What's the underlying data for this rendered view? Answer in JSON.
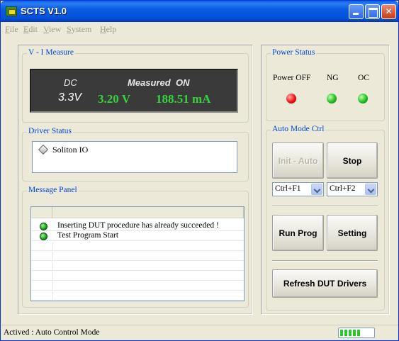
{
  "window": {
    "title": "SCTS V1.0"
  },
  "menu": {
    "items": [
      {
        "label": "File"
      },
      {
        "label": "Edit"
      },
      {
        "label": "View"
      },
      {
        "label": "System"
      },
      {
        "label": "Help"
      }
    ]
  },
  "vi_measure": {
    "group_label": "V - I Measure",
    "mode": "DC",
    "measured_label": "Measured",
    "measured_state": "ON",
    "set_voltage": "3.3V",
    "measured_voltage": "3.20 V",
    "measured_current": "188.51 mA"
  },
  "driver_status": {
    "group_label": "Driver Status",
    "items": [
      "Soliton IO"
    ]
  },
  "message_panel": {
    "group_label": "Message Panel",
    "messages": [
      "Inserting DUT procedure has already succeeded !",
      "Test Program Start"
    ]
  },
  "power_status": {
    "group_label": "Power Status",
    "indicators": [
      {
        "label": "Power OFF",
        "state": "red",
        "color": "#ee1010"
      },
      {
        "label": "NG",
        "state": "green",
        "color": "#20c020"
      },
      {
        "label": "OC",
        "state": "green",
        "color": "#20c020"
      }
    ]
  },
  "auto_mode": {
    "group_label": "Auto Mode Ctrl",
    "init_button": "Init - Auto",
    "stop_button": "Stop",
    "init_hotkey": "Ctrl+F1",
    "stop_hotkey": "Ctrl+F2"
  },
  "actions": {
    "run_prog": "Run Prog",
    "setting": "Setting",
    "refresh": "Refresh DUT Drivers"
  },
  "statusbar": {
    "text": "Actived : Auto Control Mode",
    "progress_fraction": 1.0
  }
}
